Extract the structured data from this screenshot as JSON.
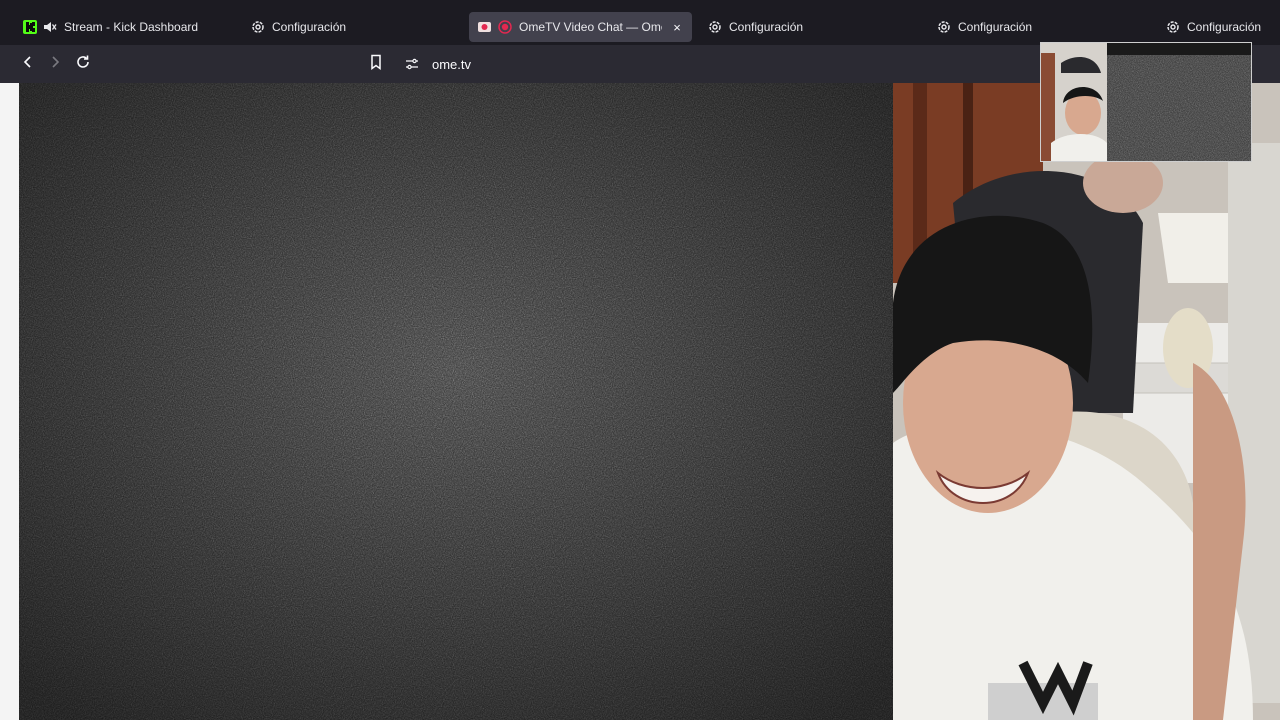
{
  "tabs": [
    {
      "label": "Stream - Kick Dashboard",
      "icon": "kick-logo-icon",
      "muted": true
    },
    {
      "label": "Configuración",
      "icon": "gear-icon"
    },
    {
      "label": "OmeTV Video Chat — Omegl",
      "icon": "camera-recording-icon",
      "active": true
    },
    {
      "label": "Configuración",
      "icon": "gear-icon"
    },
    {
      "label": "Configuración",
      "icon": "gear-icon"
    },
    {
      "label": "Configuración",
      "icon": "gear-icon"
    }
  ],
  "tab_close_glyph": "×",
  "toolbar": {
    "url": "ome.tv"
  },
  "colors": {
    "kick_green": "#53fc18",
    "tab_active_bg": "#42414d",
    "toolbar_bg": "#2b2a33",
    "record_red": "#e22850"
  }
}
